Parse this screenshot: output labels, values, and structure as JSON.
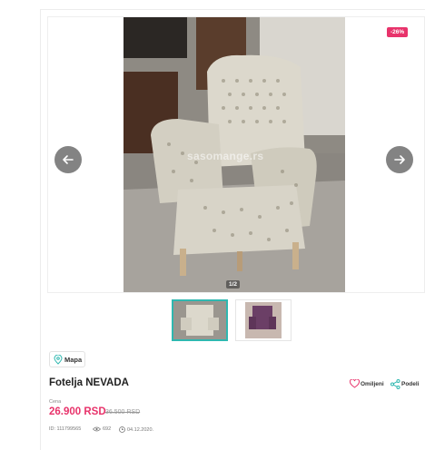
{
  "listing": {
    "discount_badge": "-26%",
    "watermark": "sasomange.rs",
    "image_counter": "1/2",
    "title": "Fotelja NEVADA",
    "price_label": "Cena",
    "price": "26.900 RSD",
    "old_price": "36.500 RSD",
    "id_text": "ID: 111799565",
    "views": "692",
    "date": "04.12.2020."
  },
  "actions": {
    "map_label": "Mapa",
    "favorite_label": "Omiljeni",
    "share_label": "Podeli"
  },
  "colors": {
    "accent_pink": "#e8336b",
    "thumb_active_border": "#2fb8b0"
  },
  "icons": [
    "arrow-left-icon",
    "arrow-right-icon",
    "map-pin-icon",
    "heart-icon",
    "share-icon",
    "id-icon",
    "eye-icon",
    "clock-icon"
  ]
}
